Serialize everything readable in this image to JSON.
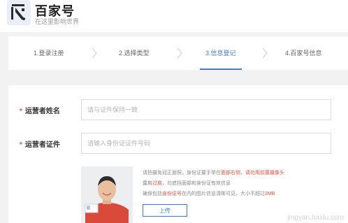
{
  "header": {
    "title": "百家号",
    "subtitle": "在这里影响世界"
  },
  "steps": [
    {
      "label": "1.登录注册",
      "active": false
    },
    {
      "label": "2.选择类型",
      "active": false
    },
    {
      "label": "3.信息登记",
      "active": true
    },
    {
      "label": "4.百家号信息",
      "active": false
    }
  ],
  "form": {
    "required_mark": "*",
    "operator_name_label": "运营者姓名",
    "operator_name_placeholder": "请与证件保持一致",
    "operator_id_label": "运营者证件",
    "operator_id_placeholder": "请输入身份证证件号码",
    "photo_note": {
      "line1_a": "请拍摄免冠正面照，身份证要手举在",
      "line1_hl1": "面部右侧",
      "line1_b": "，",
      "line1_hl2": "请勿用前置摄像头",
      "line2_a": "露肩",
      "line2_hl": "过肩",
      "line2_b": "，勿遮挡面部和身份证有效信息",
      "line3_a": "确保包括",
      "line3_hl": "身份证号",
      "line3_b": "在内的图片信息清晰可见，大小不超过",
      "line3_hl2": "2MB"
    },
    "upload_label": "上传"
  },
  "watermark_text": "jingyan.baidu.com",
  "colors": {
    "accent": "#3b7be7",
    "required": "#e84e40",
    "background": "#f2f2f2"
  }
}
